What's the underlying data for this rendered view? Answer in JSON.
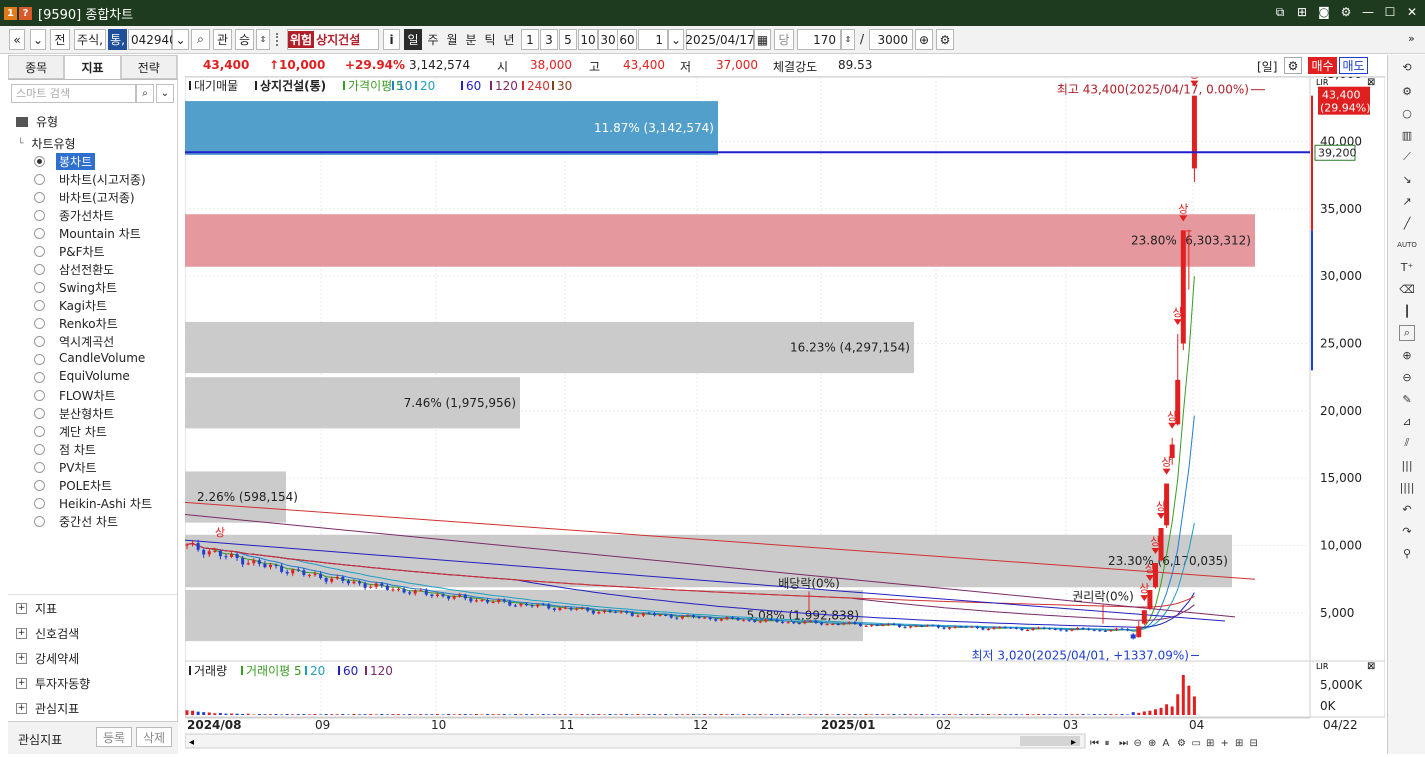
{
  "window": {
    "title": "[9590] 종합차트",
    "icon1": "1",
    "icon2": "?"
  },
  "toolbar": {
    "nav_prev": "«",
    "nav_down": "»",
    "b_jeon": "전",
    "market_type": "주식,",
    "b_tong": "통,",
    "code": "042940",
    "b_gwan": "관",
    "b_seung": "승",
    "warn_badge": "위험",
    "stock_name": "상지건설",
    "info_button": "i",
    "periods": [
      "일",
      "주",
      "월",
      "분",
      "틱",
      "년"
    ],
    "intervals": [
      "1",
      "3",
      "5",
      "10",
      "30",
      "60"
    ],
    "interval_value": "1",
    "date": "2025/04/17",
    "count_label": "당",
    "count_value": "170",
    "slash": "/",
    "total": "3000"
  },
  "left_panel": {
    "tabs": [
      "종목",
      "지표",
      "전략"
    ],
    "search_placeholder": "스마트 검색",
    "category_label": "유형",
    "chart_type_label": "차트유형",
    "chart_types": [
      "봉차트",
      "바차트(시고저종)",
      "바차트(고저종)",
      "종가선차트",
      "Mountain 차트",
      "P&F차트",
      "삼선전환도",
      "Swing차트",
      "Kagi차트",
      "Renko차트",
      "역시계곡선",
      "CandleVolume",
      "EquiVolume",
      "FLOW차트",
      "분산형차트",
      "계단 차트",
      "점 차트",
      "PV차트",
      "POLE차트",
      "Heikin-Ashi 차트",
      "중간선 차트"
    ],
    "selected_index": 0,
    "bottom_items": [
      "지표",
      "신호검색",
      "강세약세",
      "투자자동향",
      "관심지표"
    ],
    "bottom_label": "관심지표",
    "register_button": "등록",
    "delete_button": "삭제"
  },
  "price_bar": {
    "price": "43,400",
    "change": "↑10,000",
    "change_pct": "+29.94%",
    "volume": "3,142,574",
    "open_label": "시",
    "open": "38,000",
    "high_label": "고",
    "high": "43,400",
    "low_label": "저",
    "low": "37,000",
    "strength_label": "체결강도",
    "strength": "89.53",
    "period_tag": "[일]",
    "buy_button": "매수",
    "sell_button": "매도"
  },
  "colors": {
    "up": "#e02020",
    "down": "#1f3fd0",
    "ma5": "#3a9d23",
    "ma10": "#1f7fd0",
    "ma20": "#1fa0c0",
    "ma60": "#2020c0",
    "ma120": "#7a2a6a",
    "ma240": "#d23030",
    "ma30": "#804020"
  },
  "chart_legend": {
    "items": [
      "대기매물",
      "상지건설(통)",
      "가격이평 5",
      "10",
      "20",
      "60",
      "120",
      "240",
      "30"
    ]
  },
  "volume_legend": {
    "items": [
      "거래량",
      "거래이평 5",
      "20",
      "60",
      "120"
    ]
  },
  "chart_data": [
    {
      "type": "candlestick",
      "title": "상지건설(통)",
      "y_ticks": [
        "45,000",
        "40,000",
        "35,000",
        "30,000",
        "25,000",
        "20,000",
        "15,000",
        "10,000",
        "5,000"
      ],
      "x_ticks": [
        "2024/08",
        "09",
        "10",
        "11",
        "12",
        "2025/01",
        "02",
        "03",
        "04",
        "04/22"
      ],
      "ylim": [
        1500,
        48500
      ],
      "current_price_tag": "43,400",
      "current_pct_tag": "(29.94%)",
      "crosshair_value": "39,200",
      "annotations": {
        "high": "최고 43,400(2025/04/17, 0.00%)",
        "low": "최저 3,020(2025/04/01, +1337.09%)",
        "dividend": "배당락(0%)",
        "rights": "권리락(0%)",
        "limit_up": "상"
      },
      "supply_zones": [
        {
          "label": "11.87% (3,142,574)",
          "price_from": 39000,
          "price_to": 43000,
          "color": "#4a9ac8"
        },
        {
          "label": "23.80% (6,303,312)",
          "price_from": 30700,
          "price_to": 34600,
          "color": "#e4939a"
        },
        {
          "label": "16.23% (4,297,154)",
          "price_from": 22800,
          "price_to": 26600,
          "color": "#c8c8c8"
        },
        {
          "label": "7.46% (1,975,956)",
          "price_from": 18700,
          "price_to": 22500,
          "color": "#c8c8c8"
        },
        {
          "label": "2.26% (598,154)",
          "price_from": 11700,
          "price_to": 15500,
          "color": "#c8c8c8"
        },
        {
          "label": "23.30% (6,170,035)",
          "price_from": 6900,
          "price_to": 10800,
          "color": "#c8c8c8"
        },
        {
          "label": "5.08% (1,992,838)",
          "price_from": 2900,
          "price_to": 6700,
          "color": "#c8c8c8"
        }
      ],
      "candles_recent": [
        {
          "date": "2025/04/01",
          "open": 3400,
          "high": 3500,
          "low": 3020,
          "close": 3100
        },
        {
          "date": "2025/04/02",
          "open": 3200,
          "high": 4400,
          "low": 3150,
          "close": 4000
        },
        {
          "date": "2025/04/03",
          "open": 4200,
          "high": 5200,
          "low": 4100,
          "close": 5200
        },
        {
          "date": "2025/04/04",
          "open": 5300,
          "high": 6700,
          "low": 5200,
          "close": 6700
        },
        {
          "date": "2025/04/07",
          "open": 6900,
          "high": 8700,
          "low": 6800,
          "close": 8700
        },
        {
          "date": "2025/04/08",
          "open": 8900,
          "high": 11300,
          "low": 8800,
          "close": 11300
        },
        {
          "date": "2025/04/09",
          "open": 11500,
          "high": 14600,
          "low": 11300,
          "close": 14600
        },
        {
          "date": "2025/04/10",
          "open": 16500,
          "high": 18000,
          "low": 16000,
          "close": 17500
        },
        {
          "date": "2025/04/11",
          "open": 19000,
          "high": 25700,
          "low": 18900,
          "close": 22300
        },
        {
          "date": "2025/04/14",
          "open": 25000,
          "high": 33400,
          "low": 24500,
          "close": 33400
        },
        {
          "date": "2025/04/15",
          "open": 33400,
          "high": 33400,
          "low": 29000,
          "close": 33400
        },
        {
          "date": "2025/04/17",
          "open": 38000,
          "high": 43400,
          "low": 37000,
          "close": 43400
        }
      ]
    },
    {
      "type": "bar",
      "title": "거래량",
      "y_ticks": [
        "5,000K",
        "0K"
      ],
      "ylim": [
        0,
        7000
      ]
    }
  ]
}
